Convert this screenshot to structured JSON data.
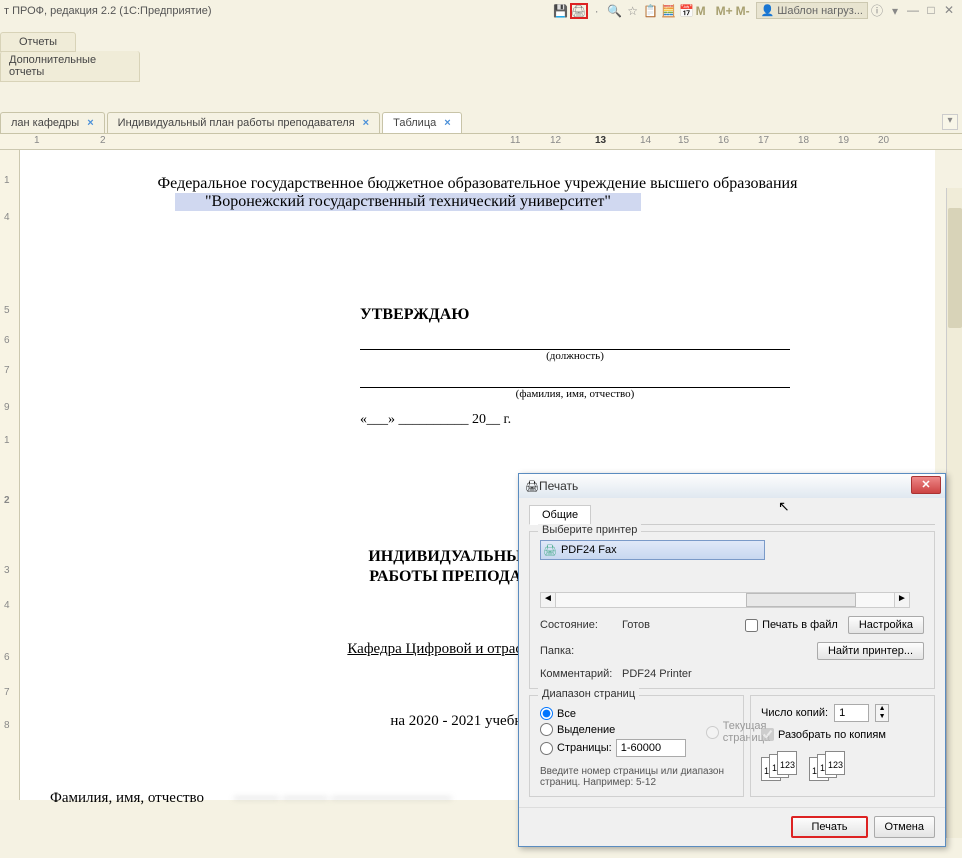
{
  "titlebar": {
    "title": "т ПРОФ, редакция 2.2  (1С:Предприятие)",
    "template_button": "Шаблон нагруз...",
    "m": "M",
    "mplus": "M+",
    "mminus": "M-"
  },
  "reports": {
    "btn1": "Отчеты",
    "btn2": "Дополнительные отчеты"
  },
  "tabs": [
    {
      "label": "лан кафедры",
      "close": "×"
    },
    {
      "label": "Индивидуальный план работы преподавателя",
      "close": "×"
    },
    {
      "label": "Таблица",
      "close": "×"
    }
  ],
  "ruler_cols": [
    "1",
    "2",
    "11",
    "12",
    "13",
    "14",
    "15",
    "16",
    "17",
    "18",
    "19",
    "20"
  ],
  "document": {
    "inst1": "Федеральное государственное бюджетное образовательное учреждение высшего образования",
    "inst2": "\"Воронежский государственный технический университет\"",
    "approve_title": "УТВЕРЖДАЮ",
    "position_hint": "(должность)",
    "fio_hint": "(фамилия, имя, отчество)",
    "date_line": "«___» __________ 20__   г.",
    "plan_title1": "ИНДИВИДУАЛЬНЫЙ ПЛАН",
    "plan_title2": "РАБОТЫ ПРЕПОДАВАТЕЛЯ",
    "kaf": "Кафедра Цифровой и отраслевой эконом",
    "year": "на 2020 - 2021 учебный год",
    "fio_label": "Фамилия, имя, отчество",
    "fio_value": "——— ——— ————————"
  },
  "print_dialog": {
    "title": "Печать",
    "tab": "Общие",
    "choose_printer": "Выберите принтер",
    "printer_name": "PDF24 Fax",
    "state_label": "Состояние:",
    "state_val": "Готов",
    "folder_label": "Папка:",
    "folder_val": "",
    "comment_label": "Комментарий:",
    "comment_val": "PDF24 Printer",
    "print_to_file": "Печать в файл",
    "settings_btn": "Настройка",
    "find_printer_btn": "Найти принтер...",
    "range_title": "Диапазон страниц",
    "range_all": "Все",
    "range_current": "Текущая страница",
    "range_selection": "Выделение",
    "range_pages": "Страницы:",
    "range_pages_value": "1-60000",
    "range_hint": "Введите номер страницы или диапазон страниц. Например: 5-12",
    "copies_title": "Число копий:",
    "copies_value": "1",
    "collate": "Разобрать по копиям",
    "page_numbers": "123",
    "footer_print": "Печать",
    "footer_cancel": "Отмена"
  }
}
